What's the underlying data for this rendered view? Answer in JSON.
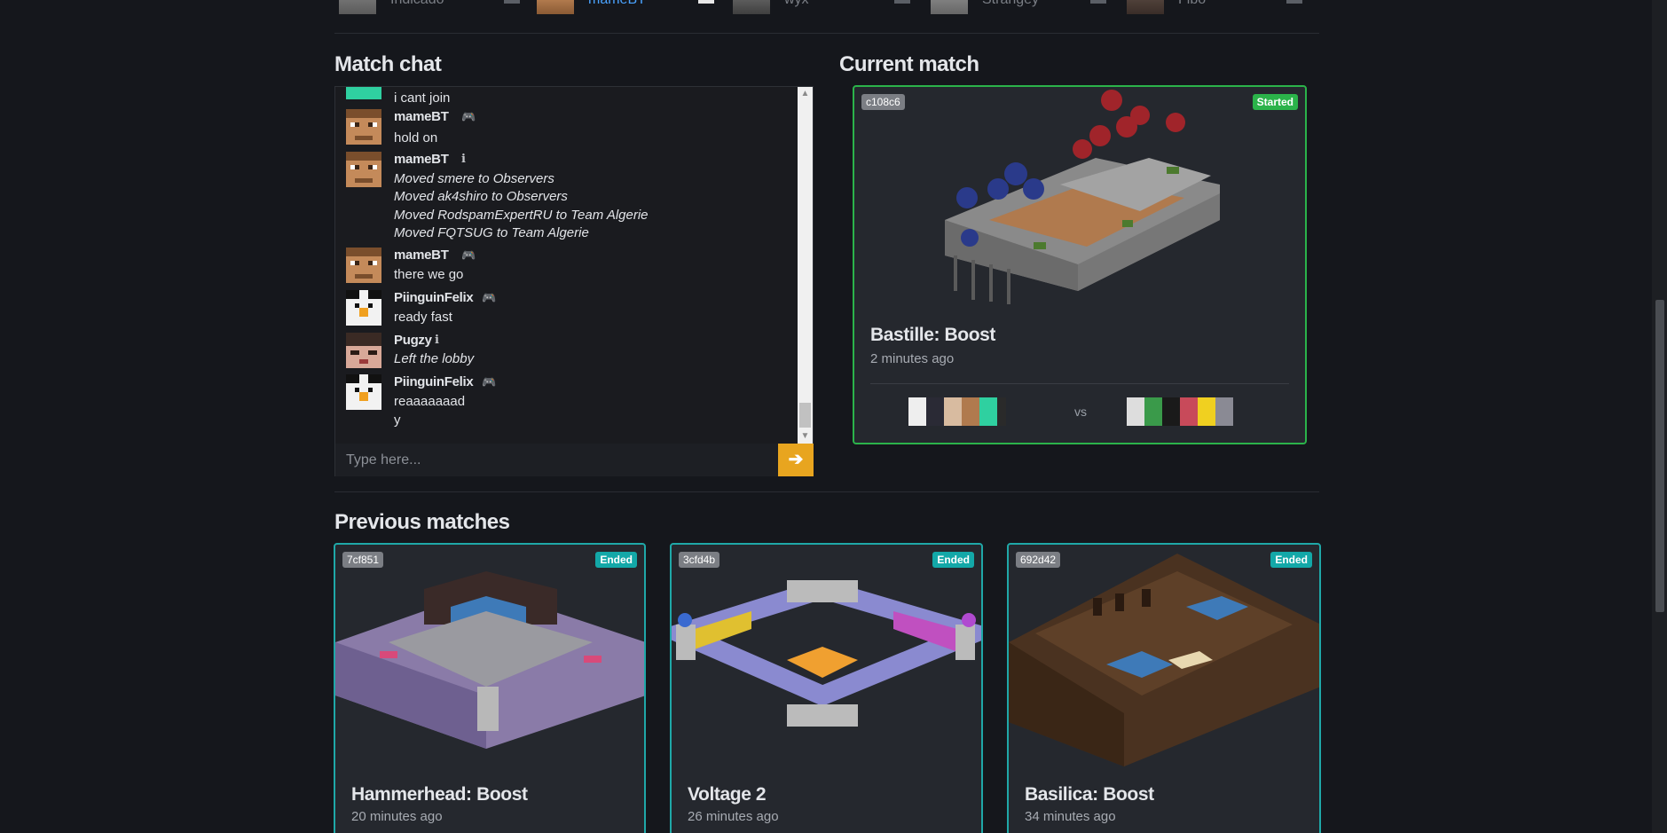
{
  "players_strip": [
    {
      "name": "Indicado",
      "me": false
    },
    {
      "name": "mameBT",
      "me": true
    },
    {
      "name": "wyx",
      "me": false
    },
    {
      "name": "Strangey",
      "me": false
    },
    {
      "name": "Fibo",
      "me": false
    }
  ],
  "chat": {
    "title": "Match chat",
    "messages": [
      {
        "user": "",
        "icon": "",
        "lines": [
          "i cant join"
        ],
        "system": false
      },
      {
        "user": "mameBT",
        "icon": "gamepad-icon",
        "lines": [
          "hold on"
        ],
        "system": false
      },
      {
        "user": "mameBT",
        "icon": "info-icon",
        "lines": [
          "Moved smere to Observers",
          "Moved ak4shiro to Observers",
          "Moved RodspamExpertRU to Team Algerie",
          "Moved FQTSUG to Team Algerie"
        ],
        "system": true
      },
      {
        "user": "mameBT",
        "icon": "gamepad-icon",
        "lines": [
          "there we go"
        ],
        "system": false
      },
      {
        "user": "PiinguinFelix",
        "icon": "gamepad-icon",
        "lines": [
          "ready fast"
        ],
        "system": false
      },
      {
        "user": "Pugzy",
        "icon": "info-icon",
        "lines": [
          "Left the lobby"
        ],
        "system": true
      },
      {
        "user": "PiinguinFelix",
        "icon": "gamepad-icon",
        "lines": [
          "reaaaaaaad",
          "y"
        ],
        "system": false
      }
    ],
    "input_placeholder": "Type here...",
    "send_icon": "arrow-right-icon"
  },
  "current_match": {
    "title": "Current match",
    "id": "c108c6",
    "status": "Started",
    "map": "Bastille: Boost",
    "time": "2 minutes ago",
    "vs": "vs"
  },
  "previous": {
    "title": "Previous matches",
    "matches": [
      {
        "id": "7cf851",
        "status": "Ended",
        "map": "Hammerhead: Boost",
        "time": "20 minutes ago"
      },
      {
        "id": "3cfd4b",
        "status": "Ended",
        "map": "Voltage 2",
        "time": "26 minutes ago"
      },
      {
        "id": "692d42",
        "status": "Ended",
        "map": "Basilica: Boost",
        "time": "34 minutes ago"
      }
    ]
  },
  "colors": {
    "accent": "#e8a51f",
    "started": "#2bb34a",
    "ended": "#13a8a8",
    "username_me": "#4aa3ff"
  }
}
